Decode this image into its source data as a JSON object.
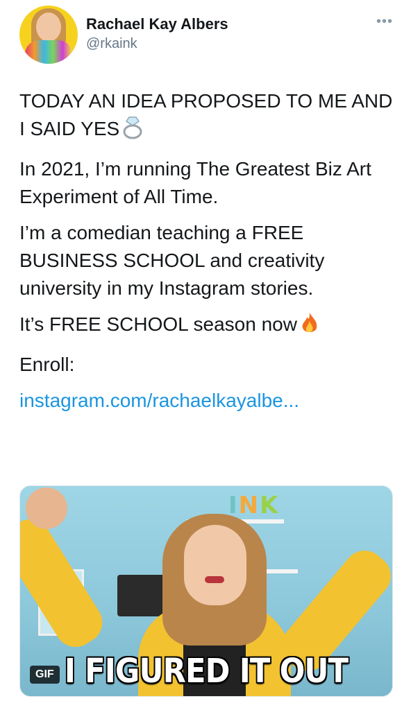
{
  "tweet": {
    "author_name": "Rachael Kay Albers",
    "author_handle": "@rkaink",
    "more_icon": "more-horizontal-icon",
    "paragraphs": [
      "TODAY AN IDEA PROPOSED TO ME AND I SAID YES",
      "In 2021, I’m running The Greatest Biz Art Experiment of All Time.",
      "I’m a comedian teaching a FREE BUSINESS SCHOOL and creativity university in my Instagram stories.",
      "It’s FREE SCHOOL season now",
      "Enroll:"
    ],
    "link_text": "instagram.com/rachaelkayalbe...",
    "icons": {
      "ring": "ring-icon",
      "fire": "fire-icon"
    }
  },
  "media": {
    "caption": "I FIGURED IT OUT",
    "badge": "GIF",
    "sign_text_1": "I",
    "sign_text_2": "N",
    "sign_text_3": "K"
  },
  "colors": {
    "link": "#1b95e0",
    "secondary_text": "#657786",
    "primary_text": "#14171a"
  }
}
